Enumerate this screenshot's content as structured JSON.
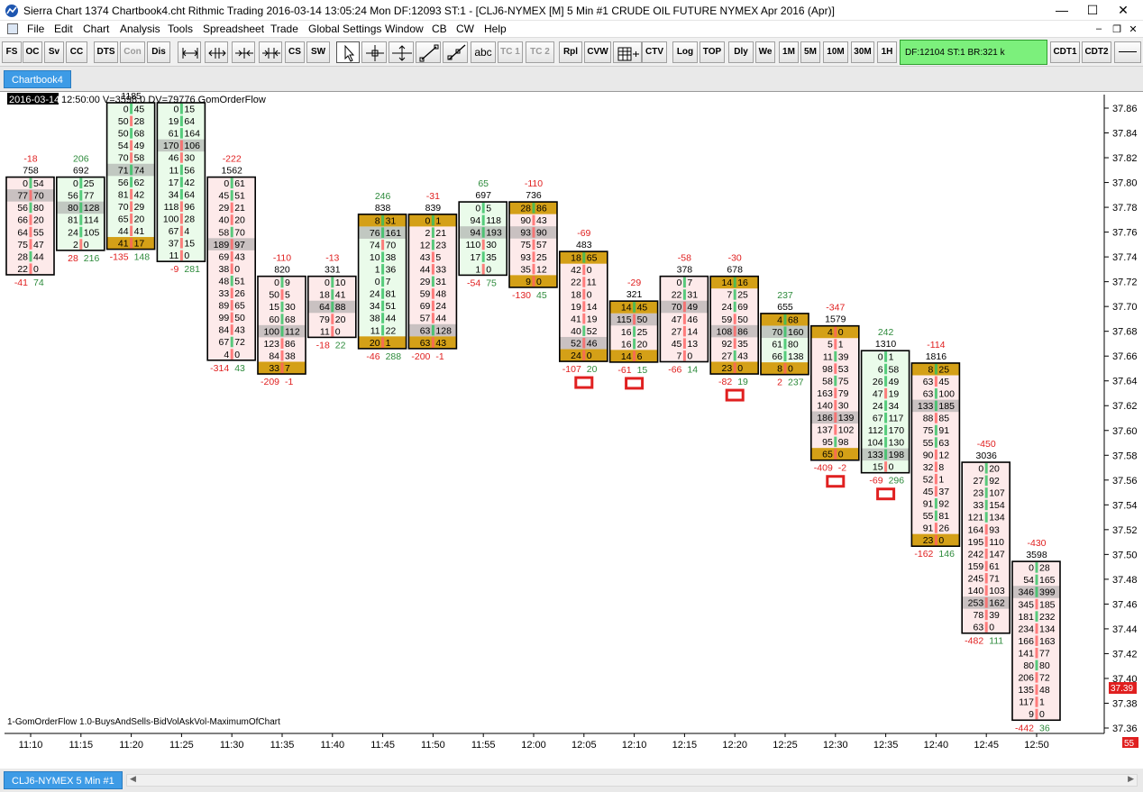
{
  "window": {
    "title": "Sierra Chart 1374 Chartbook4.cht  Rithmic Trading 2016-03-14  13:05:24 Mon  DF:12093  ST:1 - [CLJ6-NYMEX [M]  5 Min  #1  CRUDE OIL FUTURE NYMEX Apr 2016 (Apr)]",
    "minimize": "—",
    "maximize": "☐",
    "close": "✕"
  },
  "menu": {
    "items": [
      "File",
      "Edit",
      "Chart",
      "Analysis",
      "Tools",
      "Spreadsheet",
      "Trade",
      "Global Settings",
      "Window",
      "CB",
      "CW",
      "Help"
    ],
    "mdi_min": "–",
    "mdi_restore": "❐",
    "mdi_close": "✕"
  },
  "toolbar": {
    "buttons": [
      "FS",
      "OC",
      "Sv",
      "CC",
      "DTS",
      "Con",
      "Dis",
      "",
      "",
      "",
      "",
      "CS",
      "SW",
      "",
      "",
      "",
      "",
      "",
      "abc",
      "TC 1",
      "TC 2",
      "Rpl",
      "CVW",
      "",
      "CTV",
      "Log",
      "TOP",
      "Dly",
      "We",
      "1M",
      "5M",
      "10M",
      "30M",
      "1H",
      "CDT1",
      "CDT2",
      "——"
    ],
    "status": "DF:12104  ST:1  BR:321 k"
  },
  "tab": {
    "label": "Chartbook4"
  },
  "bottom_tab": {
    "label": "CLJ6-NYMEX   5 Min   #1"
  },
  "chart_header": {
    "date": "2016-03-14",
    "info": "12:50:00 V=3598.0 DV=79776  GomOrderFlow"
  },
  "study_label": "1-GomOrderFlow 1.0-BuysAndSells-BidVolAskVol-MaximumOfChart",
  "price_marker": "37.39",
  "corner_marker": "55",
  "chart_data": {
    "type": "table",
    "y_axis_ticks": [
      "37.86",
      "37.84",
      "37.82",
      "37.80",
      "37.78",
      "37.76",
      "37.74",
      "37.72",
      "37.70",
      "37.68",
      "37.66",
      "37.64",
      "37.62",
      "37.60",
      "37.58",
      "37.56",
      "37.54",
      "37.52",
      "37.50",
      "37.48",
      "37.46",
      "37.44",
      "37.42",
      "37.40",
      "37.38",
      "37.36"
    ],
    "y_range": [
      37.36,
      37.86
    ],
    "x_ticks": [
      "11:10",
      "11:15",
      "11:20",
      "11:25",
      "11:30",
      "11:35",
      "11:40",
      "11:45",
      "11:50",
      "11:55",
      "12:00",
      "12:05",
      "12:10",
      "12:15",
      "12:20",
      "12:25",
      "12:30",
      "12:35",
      "12:40",
      "12:45",
      "12:50"
    ],
    "bars": [
      {
        "time": "11:10",
        "delta": "-18",
        "delta_dir": "down",
        "volume": "758",
        "top": 37.8,
        "rows": [
          [
            "0",
            "54"
          ],
          [
            "77",
            "70"
          ],
          [
            "56",
            "80"
          ],
          [
            "66",
            "20"
          ],
          [
            "64",
            "55"
          ],
          [
            "75",
            "47"
          ],
          [
            "28",
            "44"
          ],
          [
            "22",
            "0"
          ]
        ],
        "footer_bid": "-41",
        "footer_ask": "74"
      },
      {
        "time": "11:15",
        "delta": "206",
        "delta_dir": "up",
        "volume": "692",
        "top": 37.8,
        "rows": [
          [
            "0",
            "25"
          ],
          [
            "56",
            "77"
          ],
          [
            "80",
            "128"
          ],
          [
            "81",
            "114"
          ],
          [
            "24",
            "105"
          ],
          [
            "2",
            "0"
          ]
        ],
        "footer_bid": "28",
        "footer_ask": "216"
      },
      {
        "time": "11:20",
        "delta": "",
        "delta_dir": "up",
        "volume": "1185",
        "top": 37.86,
        "rows": [
          [
            "0",
            "45"
          ],
          [
            "50",
            "28"
          ],
          [
            "50",
            "68"
          ],
          [
            "54",
            "49"
          ],
          [
            "70",
            "58"
          ],
          [
            "71",
            "74"
          ],
          [
            "56",
            "62"
          ],
          [
            "81",
            "42"
          ],
          [
            "70",
            "29"
          ],
          [
            "65",
            "20"
          ],
          [
            "44",
            "41"
          ],
          [
            "41",
            "17"
          ]
        ],
        "footer_bid": "-135",
        "footer_ask": "148"
      },
      {
        "time": "11:25",
        "delta": "",
        "delta_dir": "up",
        "volume": "",
        "top": 37.86,
        "rows": [
          [
            "0",
            "15"
          ],
          [
            "19",
            "64"
          ],
          [
            "61",
            "164"
          ],
          [
            "170",
            "106"
          ],
          [
            "46",
            "30"
          ],
          [
            "11",
            "56"
          ],
          [
            "17",
            "42"
          ],
          [
            "34",
            "64"
          ],
          [
            "118",
            "96"
          ],
          [
            "100",
            "28"
          ],
          [
            "67",
            "4"
          ],
          [
            "37",
            "15"
          ],
          [
            "11",
            "0"
          ]
        ],
        "footer_bid": "-9",
        "footer_ask": "281"
      },
      {
        "time": "11:30",
        "delta": "-222",
        "delta_dir": "down",
        "volume": "1562",
        "top": 37.8,
        "rows": [
          [
            "0",
            "61"
          ],
          [
            "45",
            "51"
          ],
          [
            "29",
            "21"
          ],
          [
            "40",
            "20"
          ],
          [
            "58",
            "70"
          ],
          [
            "189",
            "97"
          ],
          [
            "69",
            "43"
          ],
          [
            "38",
            "0"
          ],
          [
            "48",
            "51"
          ],
          [
            "33",
            "26"
          ],
          [
            "89",
            "65"
          ],
          [
            "99",
            "50"
          ],
          [
            "84",
            "43"
          ],
          [
            "67",
            "72"
          ],
          [
            "4",
            "0"
          ]
        ],
        "footer_bid": "-314",
        "footer_ask": "43"
      },
      {
        "time": "11:35",
        "delta": "-110",
        "delta_dir": "down",
        "volume": "820",
        "top": 37.72,
        "rows": [
          [
            "0",
            "9"
          ],
          [
            "50",
            "5"
          ],
          [
            "15",
            "30"
          ],
          [
            "60",
            "68"
          ],
          [
            "100",
            "112"
          ],
          [
            "123",
            "86"
          ],
          [
            "84",
            "38"
          ],
          [
            "33",
            "7"
          ]
        ],
        "footer_bid": "-209",
        "footer_ask": "-1"
      },
      {
        "time": "11:40",
        "delta": "-13",
        "delta_dir": "down",
        "volume": "331",
        "top": 37.72,
        "rows": [
          [
            "0",
            "10"
          ],
          [
            "18",
            "41"
          ],
          [
            "64",
            "88"
          ],
          [
            "79",
            "20"
          ],
          [
            "11",
            "0"
          ]
        ],
        "footer_bid": "-18",
        "footer_ask": "22"
      },
      {
        "time": "11:45",
        "delta": "246",
        "delta_dir": "up",
        "volume": "838",
        "top": 37.77,
        "rows": [
          [
            "8",
            "31"
          ],
          [
            "76",
            "161"
          ],
          [
            "74",
            "70"
          ],
          [
            "10",
            "38"
          ],
          [
            "1",
            "36"
          ],
          [
            "0",
            "7"
          ],
          [
            "24",
            "81"
          ],
          [
            "34",
            "51"
          ],
          [
            "38",
            "44"
          ],
          [
            "11",
            "22"
          ],
          [
            "20",
            "1"
          ]
        ],
        "footer_bid": "-46",
        "footer_ask": "288"
      },
      {
        "time": "11:50",
        "delta": "-31",
        "delta_dir": "down",
        "volume": "839",
        "top": 37.77,
        "rows": [
          [
            "0",
            "1"
          ],
          [
            "2",
            "21"
          ],
          [
            "12",
            "23"
          ],
          [
            "43",
            "5"
          ],
          [
            "44",
            "33"
          ],
          [
            "29",
            "31"
          ],
          [
            "59",
            "48"
          ],
          [
            "69",
            "24"
          ],
          [
            "57",
            "44"
          ],
          [
            "63",
            "128"
          ],
          [
            "63",
            "43"
          ]
        ],
        "footer_bid": "-200",
        "footer_ask": "-1"
      },
      {
        "time": "11:55",
        "delta": "65",
        "delta_dir": "up",
        "volume": "697",
        "top": 37.78,
        "rows": [
          [
            "0",
            "5"
          ],
          [
            "94",
            "118"
          ],
          [
            "94",
            "193"
          ],
          [
            "110",
            "30"
          ],
          [
            "17",
            "35"
          ],
          [
            "1",
            "0"
          ]
        ],
        "footer_bid": "-54",
        "footer_ask": "75"
      },
      {
        "time": "12:00",
        "delta": "-110",
        "delta_dir": "down",
        "volume": "736",
        "top": 37.78,
        "rows": [
          [
            "28",
            "86"
          ],
          [
            "90",
            "43"
          ],
          [
            "93",
            "90"
          ],
          [
            "75",
            "57"
          ],
          [
            "93",
            "25"
          ],
          [
            "35",
            "12"
          ],
          [
            "9",
            "0"
          ]
        ],
        "footer_bid": "-130",
        "footer_ask": "45"
      },
      {
        "time": "12:05",
        "delta": "-69",
        "delta_dir": "down",
        "volume": "483",
        "top": 37.74,
        "rows": [
          [
            "18",
            "65"
          ],
          [
            "42",
            "0"
          ],
          [
            "22",
            "11"
          ],
          [
            "18",
            "0"
          ],
          [
            "19",
            "14"
          ],
          [
            "41",
            "19"
          ],
          [
            "40",
            "52"
          ],
          [
            "52",
            "46"
          ],
          [
            "24",
            "0"
          ]
        ],
        "footer_bid": "-107",
        "footer_ask": "20"
      },
      {
        "time": "12:10",
        "delta": "-29",
        "delta_dir": "down",
        "volume": "321",
        "top": 37.7,
        "rows": [
          [
            "14",
            "45"
          ],
          [
            "115",
            "50"
          ],
          [
            "16",
            "25"
          ],
          [
            "16",
            "20"
          ],
          [
            "14",
            "6"
          ]
        ],
        "footer_bid": "-61",
        "footer_ask": "15"
      },
      {
        "time": "12:15",
        "delta": "-58",
        "delta_dir": "down",
        "volume": "378",
        "top": 37.72,
        "rows": [
          [
            "0",
            "7"
          ],
          [
            "22",
            "31"
          ],
          [
            "70",
            "49"
          ],
          [
            "47",
            "46"
          ],
          [
            "27",
            "14"
          ],
          [
            "45",
            "13"
          ],
          [
            "7",
            "0"
          ]
        ],
        "footer_bid": "-66",
        "footer_ask": "14"
      },
      {
        "time": "12:20",
        "delta": "-30",
        "delta_dir": "down",
        "volume": "678",
        "top": 37.72,
        "rows": [
          [
            "14",
            "16"
          ],
          [
            "7",
            "25"
          ],
          [
            "24",
            "69"
          ],
          [
            "59",
            "50"
          ],
          [
            "108",
            "86"
          ],
          [
            "92",
            "35"
          ],
          [
            "27",
            "43"
          ],
          [
            "23",
            "0"
          ]
        ],
        "footer_bid": "-82",
        "footer_ask": "19"
      },
      {
        "time": "12:25",
        "delta": "237",
        "delta_dir": "up",
        "volume": "655",
        "top": 37.69,
        "rows": [
          [
            "4",
            "68"
          ],
          [
            "70",
            "160"
          ],
          [
            "61",
            "80"
          ],
          [
            "66",
            "138"
          ],
          [
            "8",
            "0"
          ]
        ],
        "footer_bid": "2",
        "footer_ask": "237"
      },
      {
        "time": "12:30",
        "delta": "-347",
        "delta_dir": "down",
        "volume": "1579",
        "top": 37.68,
        "rows": [
          [
            "4",
            "0"
          ],
          [
            "5",
            "1"
          ],
          [
            "11",
            "39"
          ],
          [
            "98",
            "53"
          ],
          [
            "58",
            "75"
          ],
          [
            "163",
            "79"
          ],
          [
            "140",
            "30"
          ],
          [
            "186",
            "139"
          ],
          [
            "137",
            "102"
          ],
          [
            "95",
            "98"
          ],
          [
            "65",
            "0"
          ]
        ],
        "footer_bid": "-409",
        "footer_ask": "-2"
      },
      {
        "time": "12:35",
        "delta": "242",
        "delta_dir": "up",
        "volume": "1310",
        "top": 37.66,
        "rows": [
          [
            "0",
            "1"
          ],
          [
            "6",
            "58"
          ],
          [
            "26",
            "49"
          ],
          [
            "47",
            "19"
          ],
          [
            "24",
            "34"
          ],
          [
            "67",
            "117"
          ],
          [
            "112",
            "170"
          ],
          [
            "104",
            "130"
          ],
          [
            "133",
            "198"
          ],
          [
            "15",
            "0"
          ]
        ],
        "footer_bid": "-69",
        "footer_ask": "296"
      },
      {
        "time": "12:40",
        "delta": "-114",
        "delta_dir": "down",
        "volume": "1816",
        "top": 37.65,
        "rows": [
          [
            "8",
            "25"
          ],
          [
            "63",
            "45"
          ],
          [
            "63",
            "100"
          ],
          [
            "133",
            "185"
          ],
          [
            "88",
            "85"
          ],
          [
            "75",
            "91"
          ],
          [
            "55",
            "63"
          ],
          [
            "90",
            "12"
          ],
          [
            "32",
            "8"
          ],
          [
            "52",
            "1"
          ],
          [
            "45",
            "37"
          ],
          [
            "91",
            "92"
          ],
          [
            "55",
            "81"
          ],
          [
            "91",
            "26"
          ],
          [
            "23",
            "0"
          ]
        ],
        "footer_bid": "-162",
        "footer_ask": "146"
      },
      {
        "time": "12:45",
        "delta": "-450",
        "delta_dir": "down",
        "volume": "3036",
        "top": 37.57,
        "rows": [
          [
            "0",
            "20"
          ],
          [
            "27",
            "92"
          ],
          [
            "23",
            "107"
          ],
          [
            "33",
            "154"
          ],
          [
            "121",
            "134"
          ],
          [
            "164",
            "93"
          ],
          [
            "195",
            "110"
          ],
          [
            "242",
            "147"
          ],
          [
            "159",
            "61"
          ],
          [
            "245",
            "71"
          ],
          [
            "140",
            "103"
          ],
          [
            "253",
            "162"
          ],
          [
            "78",
            "39"
          ],
          [
            "63",
            "0"
          ]
        ],
        "footer_bid": "-482",
        "footer_ask": "111"
      },
      {
        "time": "12:50",
        "delta": "-430",
        "delta_dir": "down",
        "volume": "3598",
        "top": 37.49,
        "rows": [
          [
            "0",
            "28"
          ],
          [
            "54",
            "165"
          ],
          [
            "346",
            "399"
          ],
          [
            "345",
            "185"
          ],
          [
            "181",
            "232"
          ],
          [
            "234",
            "134"
          ],
          [
            "166",
            "163"
          ],
          [
            "141",
            "77"
          ],
          [
            "80",
            "80"
          ],
          [
            "206",
            "72"
          ],
          [
            "135",
            "48"
          ],
          [
            "117",
            "1"
          ],
          [
            "9",
            "0"
          ]
        ],
        "footer_bid": "-442",
        "footer_ask": "36"
      }
    ],
    "markers": [
      "12:05",
      "12:10",
      "12:20",
      "12:30",
      "12:35"
    ]
  },
  "colors": {
    "title_bg": "#ffffff",
    "gold_row": "#d4a017",
    "poc_row": "#9e9e9e",
    "up_text": "#2e8b3c",
    "down_text": "#e02020",
    "bar_up": "#30c060",
    "bar_down": "#ff6060",
    "tab_blue": "#3d9be6",
    "status_green": "#7cf07c"
  }
}
